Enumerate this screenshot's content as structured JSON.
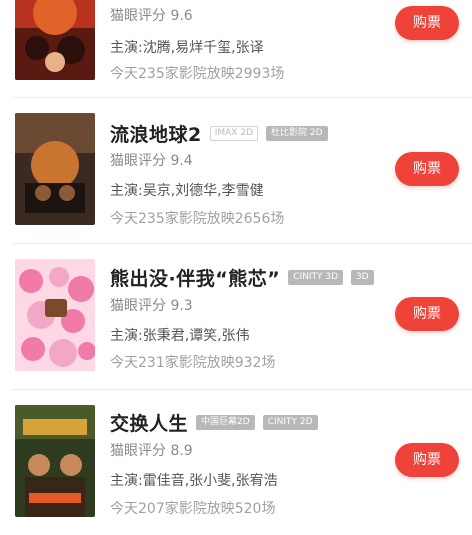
{
  "movies": [
    {
      "title": "",
      "tags": [],
      "score_label": "猫眼评分",
      "score": "9.6",
      "cast": "主演:沈腾,易烊千玺,张译",
      "shows": "今天235家影院放映2993场",
      "buy_label": "购票",
      "poster_colors": [
        "#b8321f",
        "#e0632a",
        "#5a1a12"
      ]
    },
    {
      "title": "流浪地球2",
      "tags": [
        "IMAX 2D",
        "杜比影院 2D"
      ],
      "score_label": "猫眼评分",
      "score": "9.4",
      "cast": "主演:吴京,刘德华,李雪健",
      "shows": "今天235家影院放映2656场",
      "buy_label": "购票",
      "poster_colors": [
        "#3b2a22",
        "#c9742f",
        "#1c1410"
      ]
    },
    {
      "title": "熊出没·伴我“熊芯”",
      "tags": [
        "CINITY 3D",
        "3D"
      ],
      "score_label": "猫眼评分",
      "score": "9.3",
      "cast": "主演:张秉君,谭笑,张伟",
      "shows": "今天231家影院放映932场",
      "buy_label": "购票",
      "poster_colors": [
        "#f3a7c6",
        "#f07aa8",
        "#ffd8e6"
      ]
    },
    {
      "title": "交换人生",
      "tags": [
        "中国巨幕2D",
        "CINITY 2D"
      ],
      "score_label": "猫眼评分",
      "score": "8.9",
      "cast": "主演:雷佳音,张小斐,张宥浩",
      "shows": "今天207家影院放映520场",
      "buy_label": "购票",
      "poster_colors": [
        "#2f3b1f",
        "#d8a33a",
        "#3a2614"
      ]
    }
  ]
}
